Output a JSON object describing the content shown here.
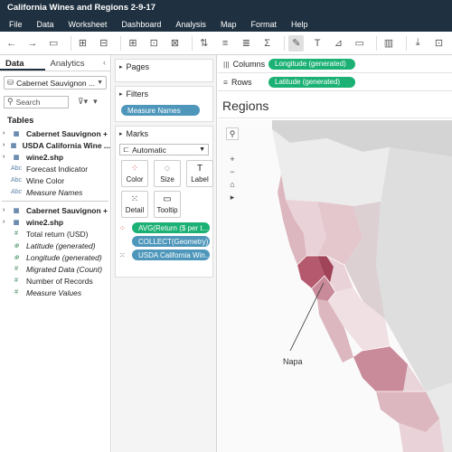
{
  "title": "California Wines and Regions 2-9-17",
  "menu": [
    "File",
    "Data",
    "Worksheet",
    "Dashboard",
    "Analysis",
    "Map",
    "Format",
    "Help"
  ],
  "datapane": {
    "tabs": [
      "Data",
      "Analytics"
    ],
    "datasource": "Cabernet Sauvignon ...",
    "search_placeholder": "Search",
    "tables_header": "Tables",
    "fields_top": [
      {
        "label": "Cabernet Sauvignon +",
        "icon": "▦",
        "style": "bold",
        "arrow": true
      },
      {
        "label": "USDA California Wine ...",
        "icon": "▦",
        "style": "bold",
        "arrow": true
      },
      {
        "label": "wine2.shp",
        "icon": "▦",
        "style": "bold",
        "arrow": true
      },
      {
        "label": "Forecast Indicator",
        "icon": "Abc",
        "style": "normal",
        "arrow": false
      },
      {
        "label": "Wine Color",
        "icon": "Abc",
        "style": "normal",
        "arrow": false
      },
      {
        "label": "Measure Names",
        "icon": "Abc",
        "style": "ital",
        "arrow": false
      }
    ],
    "fields_bottom": [
      {
        "label": "Cabernet Sauvignon +",
        "icon": "▦",
        "style": "bold",
        "arrow": true
      },
      {
        "label": "wine2.shp",
        "icon": "▦",
        "style": "bold",
        "arrow": true
      },
      {
        "label": "Total return (USD)",
        "icon": "#",
        "style": "normal",
        "arrow": false
      },
      {
        "label": "Latitude (generated)",
        "icon": "⊕",
        "style": "ital",
        "arrow": false
      },
      {
        "label": "Longitude (generated)",
        "icon": "⊕",
        "style": "ital",
        "arrow": false
      },
      {
        "label": "Migrated Data (Count)",
        "icon": "#",
        "style": "ital",
        "arrow": false
      },
      {
        "label": "Number of Records",
        "icon": "#",
        "style": "normal",
        "arrow": false
      },
      {
        "label": "Measure Values",
        "icon": "#",
        "style": "ital",
        "arrow": false
      }
    ]
  },
  "shelves": {
    "pages_label": "Pages",
    "filters_label": "Filters",
    "filter_pill": "Measure Names",
    "marks_label": "Marks",
    "mark_type": "Automatic",
    "mark_buttons": [
      {
        "label": "Color",
        "icon": "⁘"
      },
      {
        "label": "Size",
        "icon": "◌"
      },
      {
        "label": "Label",
        "icon": "T"
      },
      {
        "label": "Detail",
        "icon": "⁙"
      },
      {
        "label": "Tooltip",
        "icon": "▭"
      }
    ],
    "mark_pills": [
      {
        "label": "AVG(Return ($ per t...",
        "color": "green",
        "icon": "⁘"
      },
      {
        "label": "COLLECT(Geometry)",
        "color": "blue",
        "icon": ""
      },
      {
        "label": "USDA California Win...",
        "color": "blue",
        "icon": "⁙"
      }
    ]
  },
  "main": {
    "columns_label": "Columns",
    "columns_pill": "Longitude (generated)",
    "rows_label": "Rows",
    "rows_pill": "Latitude (generated)",
    "sheet_title": "Regions",
    "map_label": "Napa",
    "region_colors": [
      "#b55a6e",
      "#c98b99",
      "#dcb7bf",
      "#ead3d8",
      "#f3e8ea",
      "#cfcfcf"
    ]
  }
}
